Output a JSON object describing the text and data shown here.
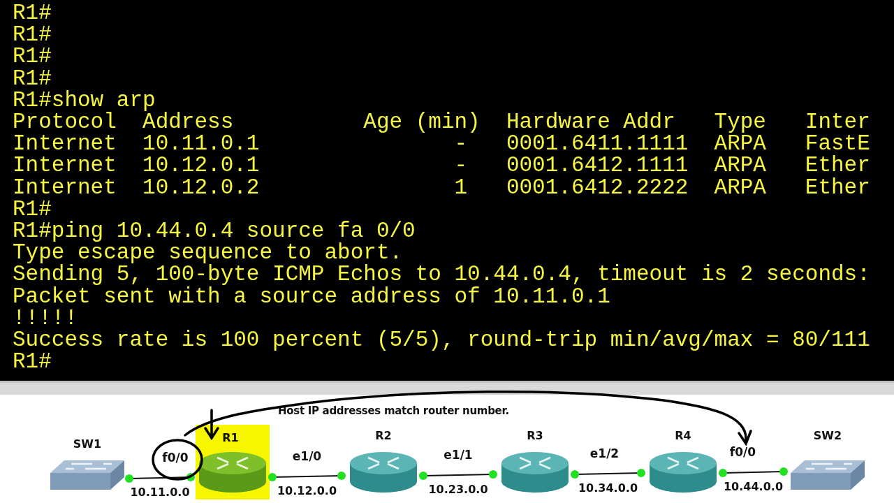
{
  "terminal": {
    "lines": [
      "R1#",
      "R1#",
      "R1#",
      "R1#",
      "R1#show arp",
      "Protocol  Address          Age (min)  Hardware Addr   Type   Inter",
      "Internet  10.11.0.1               -   0001.6411.1111  ARPA   FastE",
      "Internet  10.12.0.1               -   0001.6412.1111  ARPA   Ether",
      "Internet  10.12.0.2               1   0001.6412.2222  ARPA   Ether",
      "R1#",
      "R1#ping 10.44.0.4 source fa 0/0",
      "Type escape sequence to abort.",
      "Sending 5, 100-byte ICMP Echos to 10.44.0.4, timeout is 2 seconds:",
      "Packet sent with a source address of 10.11.0.1",
      "!!!!!",
      "Success rate is 100 percent (5/5), round-trip min/avg/max = 80/111",
      "R1#"
    ]
  },
  "diagram": {
    "note": "Host IP addresses match router number.",
    "nodes": [
      {
        "label": "SW1",
        "kind": "switch",
        "highlighted": false
      },
      {
        "label": "R1",
        "kind": "router",
        "highlighted": true
      },
      {
        "label": "R2",
        "kind": "router",
        "highlighted": false
      },
      {
        "label": "R3",
        "kind": "router",
        "highlighted": false
      },
      {
        "label": "R4",
        "kind": "router",
        "highlighted": false
      },
      {
        "label": "SW2",
        "kind": "switch",
        "highlighted": false
      }
    ],
    "links": [
      {
        "interface": "f0/0",
        "network": "10.11.0.0"
      },
      {
        "interface": "e1/0",
        "network": "10.12.0.0"
      },
      {
        "interface": "e1/1",
        "network": "10.23.0.0"
      },
      {
        "interface": "e1/2",
        "network": "10.34.0.0"
      },
      {
        "interface": "f0/0",
        "network": "10.44.0.0"
      }
    ]
  }
}
